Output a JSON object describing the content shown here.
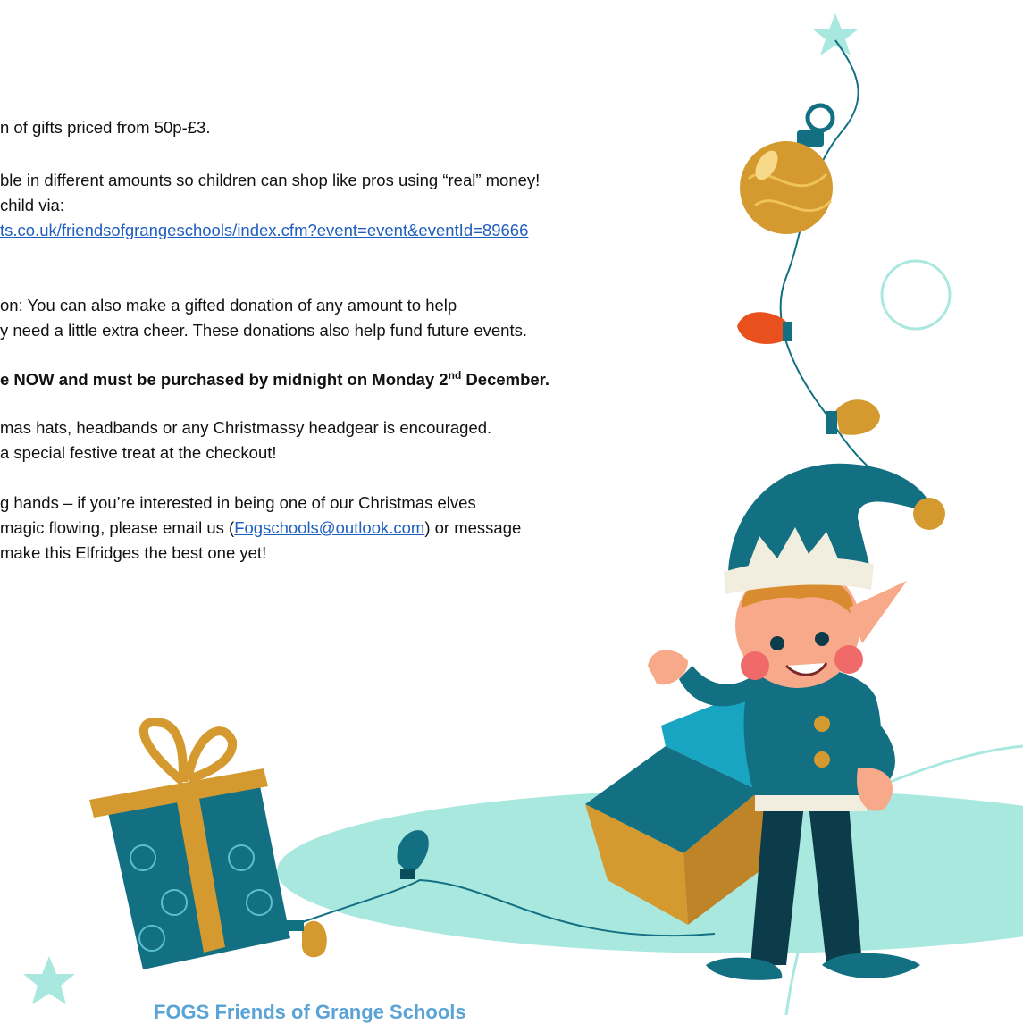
{
  "paragraphs": {
    "gifts_line": "n of gifts priced from 50p-£3.",
    "money_line1": "ble in different amounts so children can shop like pros using “real” money!",
    "money_line2": "child via:",
    "money_link": "ts.co.uk/friendsofgrangeschools/index.cfm?event=event&eventId=89666",
    "donation_line1": "on: You can also make a gifted donation of any amount to help",
    "donation_line2": "y need a little extra cheer. These donations also help fund future events.",
    "deadline_prefix": "e NOW and must be purchased by midnight on Monday 2",
    "deadline_sup": "nd",
    "deadline_suffix": " December.",
    "hats_line1": "mas hats, headbands or any Christmassy headgear is encouraged.",
    "hats_line2": "a special festive treat at the checkout!",
    "helpers_line1": "g hands – if you’re interested in being one of our Christmas elves",
    "helpers_line2_prefix": "magic flowing, please email us (",
    "helpers_email": "Fogschools@outlook.com",
    "helpers_line2_suffix": ") or message",
    "helpers_line3": "make this Elfridges the best one yet!"
  },
  "footer": {
    "text": "FOGS Friends of Grange Schools"
  },
  "colors": {
    "teal": "#136f82",
    "mint": "#a9e8df",
    "gold": "#d49a30",
    "orange_bulb": "#e8501e",
    "link": "#1f5fbf",
    "footer_text": "#5aa3d6"
  },
  "icons": [
    "star-icon",
    "ornament-icon",
    "christmas-light-icon",
    "gift-box-icon",
    "elf-illustration",
    "cardboard-box-icon"
  ]
}
